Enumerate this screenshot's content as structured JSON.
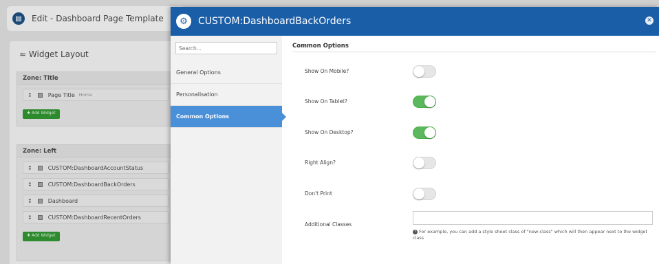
{
  "background": {
    "page_title": "Edit - Dashboard Page Template",
    "widget_layout_title": "Widget Layout",
    "zone_title": {
      "label": "Zone: Title",
      "widgets": [
        {
          "name": "Page Title",
          "sub": "Home"
        }
      ],
      "add_label": "Add Widget"
    },
    "zone_left": {
      "label": "Zone: Left",
      "widgets": [
        {
          "name": "CUSTOM:DashboardAccountStatus"
        },
        {
          "name": "CUSTOM:DashboardBackOrders"
        },
        {
          "name": "Dashboard"
        },
        {
          "name": "CUSTOM:DashboardRecentOrders"
        }
      ],
      "add_label": "Add Widget"
    }
  },
  "modal": {
    "title": "CUSTOM:DashboardBackOrders",
    "search_placeholder": "Search...",
    "nav": [
      {
        "label": "General Options",
        "active": false
      },
      {
        "label": "Personalisation",
        "active": false
      },
      {
        "label": "Common Options",
        "active": true
      }
    ],
    "section_title": "Common Options",
    "options": [
      {
        "label": "Show On Mobile?",
        "on": false
      },
      {
        "label": "Show On Tablet?",
        "on": true
      },
      {
        "label": "Show On Desktop?",
        "on": true
      },
      {
        "label": "Right Align?",
        "on": false
      },
      {
        "label": "Don't Print",
        "on": false
      }
    ],
    "additional_classes_label": "Additional Classes",
    "additional_classes_value": "",
    "help_text": "For example, you can add a style sheet class of \"new-class\" which will then appear next to the widget class"
  },
  "colors": {
    "header_blue": "#1a5ea8",
    "active_nav": "#4a90d9",
    "toggle_on": "#5cb85c"
  }
}
